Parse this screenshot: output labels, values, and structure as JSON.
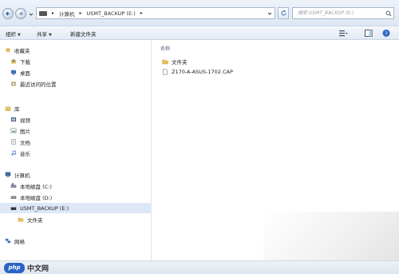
{
  "address": {
    "crumbs": [
      "计算机",
      "USMT_BACKUP (E:)"
    ],
    "separator": "▸"
  },
  "search": {
    "placeholder": "搜索 USMT_BACKUP (E:)"
  },
  "toolbar": {
    "organize": "组织",
    "share": "共享",
    "new_folder": "新建文件夹"
  },
  "sidebar": {
    "favorites": {
      "header": "收藏夹",
      "items": [
        "下载",
        "桌面",
        "最近访问的位置"
      ]
    },
    "libraries": {
      "header": "库",
      "items": [
        "视频",
        "图片",
        "文档",
        "音乐"
      ]
    },
    "computer": {
      "header": "计算机",
      "items": [
        "本地磁盘 (C:)",
        "本地磁盘 (D:)",
        "USMT_BACKUP (E:)"
      ],
      "child": "文件夹"
    },
    "network": {
      "header": "网络"
    }
  },
  "content": {
    "column_header": "名称",
    "files": [
      {
        "name": "文件夹",
        "icon": "folder-icon"
      },
      {
        "name": "Z170-A-ASUS-1702.CAP",
        "icon": "file-icon"
      }
    ]
  },
  "watermark": {
    "logo": "php",
    "text": "中文网"
  },
  "colors": {
    "selected": "#dde8f6",
    "folder": "#e8c25a",
    "accent": "#2a64c4"
  }
}
